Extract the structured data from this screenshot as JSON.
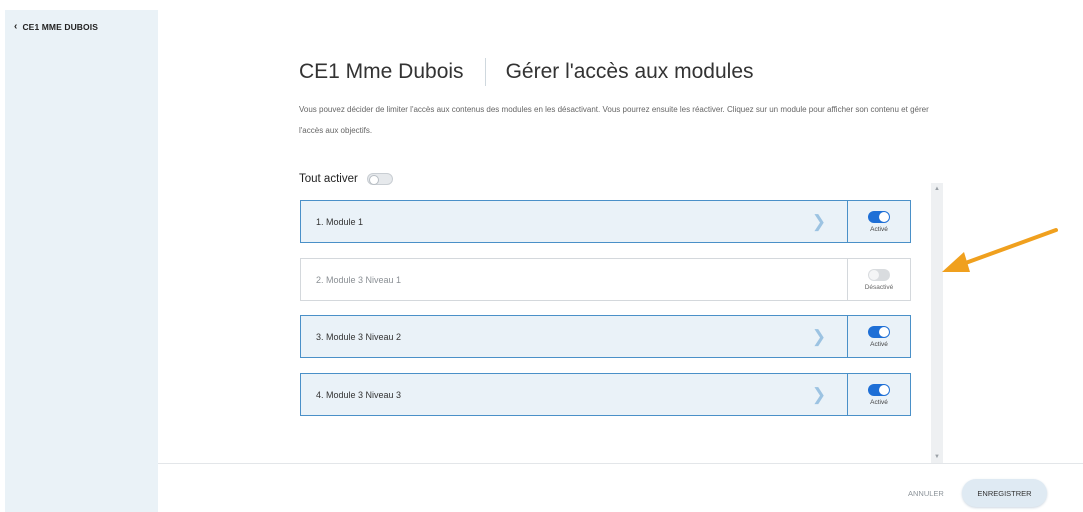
{
  "sidebar": {
    "back_label": "CE1 MME DUBOIS",
    "back_icon": "chevron-left-icon"
  },
  "header": {
    "class_name": "CE1 Mme Dubois",
    "page_title": "Gérer l'accès aux modules"
  },
  "description": "Vous pouvez décider de limiter l'accès aux contenus des modules en les désactivant. Vous pourrez ensuite les réactiver. Cliquez sur un module pour afficher son contenu et gérer l'accès aux objectifs.",
  "toggle_all": {
    "label": "Tout activer",
    "checked": false
  },
  "modules": [
    {
      "name": "1. Module 1",
      "status": "Activé",
      "active": true
    },
    {
      "name": "2. Module 3 Niveau 1",
      "status": "Désactivé",
      "active": false
    },
    {
      "name": "3. Module 3 Niveau 2",
      "status": "Activé",
      "active": true
    },
    {
      "name": "4. Module 3 Niveau 3",
      "status": "Activé",
      "active": true
    }
  ],
  "footer": {
    "cancel_label": "ANNULER",
    "save_label": "ENREGISTRER"
  },
  "colors": {
    "accent": "#1e6fd6",
    "module_border": "#4a90c8",
    "annotation_arrow": "#f0a01e"
  }
}
